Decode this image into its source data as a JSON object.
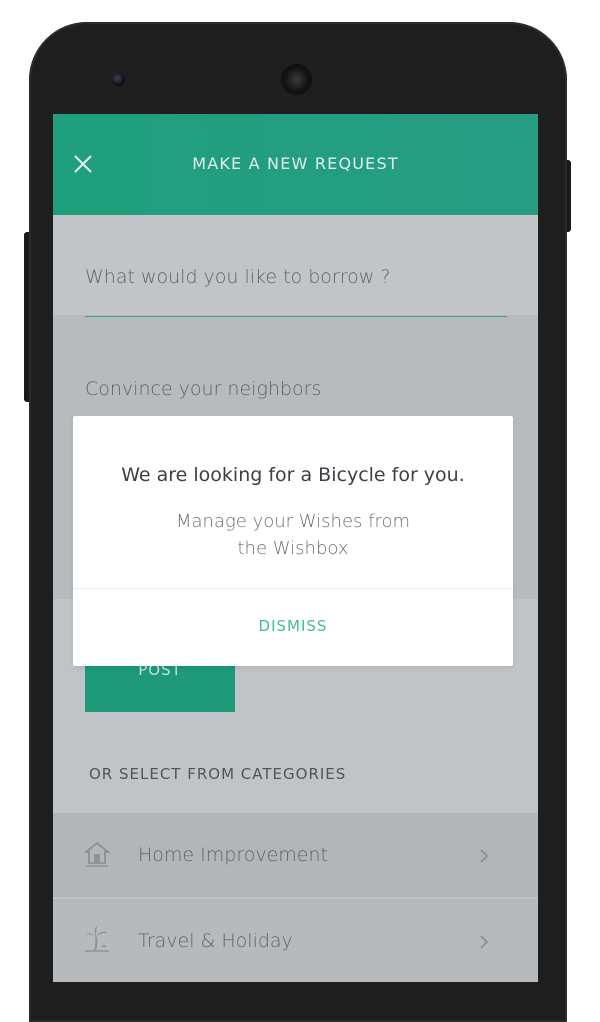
{
  "header": {
    "title": "MAKE A NEW REQUEST"
  },
  "form": {
    "borrow_placeholder": "What would you like to borrow ?",
    "convince_placeholder": "Convince your neighbors",
    "post_label": "POST"
  },
  "categories": {
    "section_title": "OR SELECT FROM CATEGORIES",
    "items": [
      {
        "label": "Home Improvement",
        "icon": "house-icon"
      },
      {
        "label": "Travel & Holiday",
        "icon": "palm-tree-icon"
      }
    ]
  },
  "dialog": {
    "title": "We are looking for a Bicycle for you.",
    "body_line1": "Manage your Wishes from",
    "body_line2": "the Wishbox",
    "dismiss_label": "DISMISS"
  },
  "colors": {
    "accent": "#1f9f7c",
    "dismiss": "#3cbf9d",
    "overlay": "#c1c4c7"
  }
}
